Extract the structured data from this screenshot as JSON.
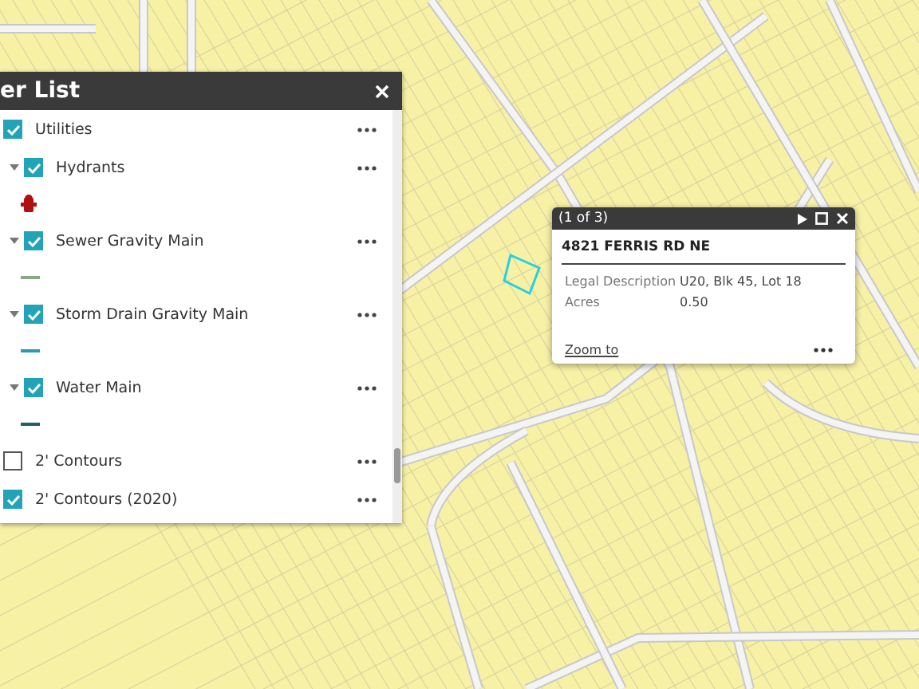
{
  "layer_panel": {
    "title": "er List",
    "layers": [
      {
        "name": "Utilities",
        "checked": true,
        "children": [
          {
            "name": "Hydrants",
            "checked": true,
            "expanded": true,
            "legend": {
              "kind": "hydrant",
              "color": "#b01010"
            }
          },
          {
            "name": "Sewer Gravity Main",
            "checked": true,
            "expanded": true,
            "legend": {
              "kind": "line",
              "color": "#8aa886"
            }
          },
          {
            "name": "Storm Drain Gravity Main",
            "checked": true,
            "expanded": true,
            "legend": {
              "kind": "line",
              "color": "#2a9ab0"
            }
          },
          {
            "name": "Water Main",
            "checked": true,
            "expanded": true,
            "legend": {
              "kind": "line",
              "color": "#1f5f6a"
            }
          }
        ]
      },
      {
        "name": "2' Contours",
        "checked": false
      },
      {
        "name": "2' Contours (2020)",
        "checked": true
      }
    ]
  },
  "popup": {
    "counter": "(1 of 3)",
    "title": "4821 FERRIS RD NE",
    "fields": [
      {
        "label": "Legal Description",
        "value": "U20, Blk 45, Lot 18"
      },
      {
        "label": "Acres",
        "value": "0.50"
      }
    ],
    "link": "Zoom to"
  }
}
